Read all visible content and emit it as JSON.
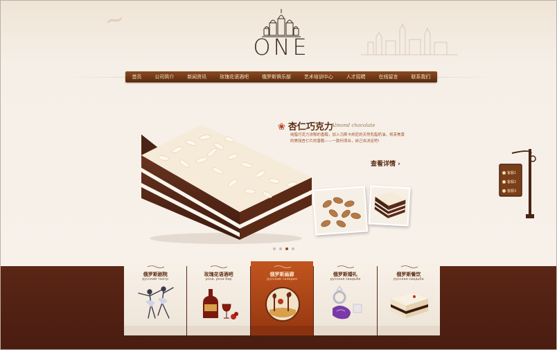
{
  "logo": {
    "text": "ONE"
  },
  "nav": {
    "items": [
      "首页",
      "公司简介",
      "新闻资讯",
      "玫瑰花语酒吧",
      "俄罗斯俱乐部",
      "艺术培训中心",
      "人才招聘",
      "在线留言",
      "联系我们"
    ]
  },
  "banner": {
    "title": "杏仁巧克力",
    "script": "Almond chocolate",
    "description": "纯脂巧克力浓郁的香醇，加入马斯卡邦尼的天然乳脂奶油，将芙焦黄的美丽杏仁片的香脆——一款何须合，自己去决定吧!",
    "more": "查看详情 ›",
    "slides_total": 4,
    "slide_active": 3
  },
  "signpost": {
    "items": [
      "客服1",
      "客服2",
      "客服3"
    ]
  },
  "cards": [
    {
      "title": "俄罗斯剧院",
      "sub": "русский театр",
      "icon": "ballet-dancers-image",
      "active": false
    },
    {
      "title": "玫瑰花语酒吧",
      "sub": "роза, роза  бар",
      "icon": "wine-bottle-image",
      "active": false
    },
    {
      "title": "俄罗斯画廊",
      "sub": "русские  галерея",
      "icon": "painting-image",
      "active": true
    },
    {
      "title": "俄罗斯婚礼",
      "sub": "русская свадьба",
      "icon": "wedding-ring-image",
      "active": false
    },
    {
      "title": "俄罗斯餐饮",
      "sub": "русская свадьба",
      "icon": "cake-slice-image",
      "active": false
    }
  ],
  "colors": {
    "brown_dark": "#4a1c10",
    "nav_brown": "#7a3e18",
    "accent_orange": "#c2551e"
  }
}
